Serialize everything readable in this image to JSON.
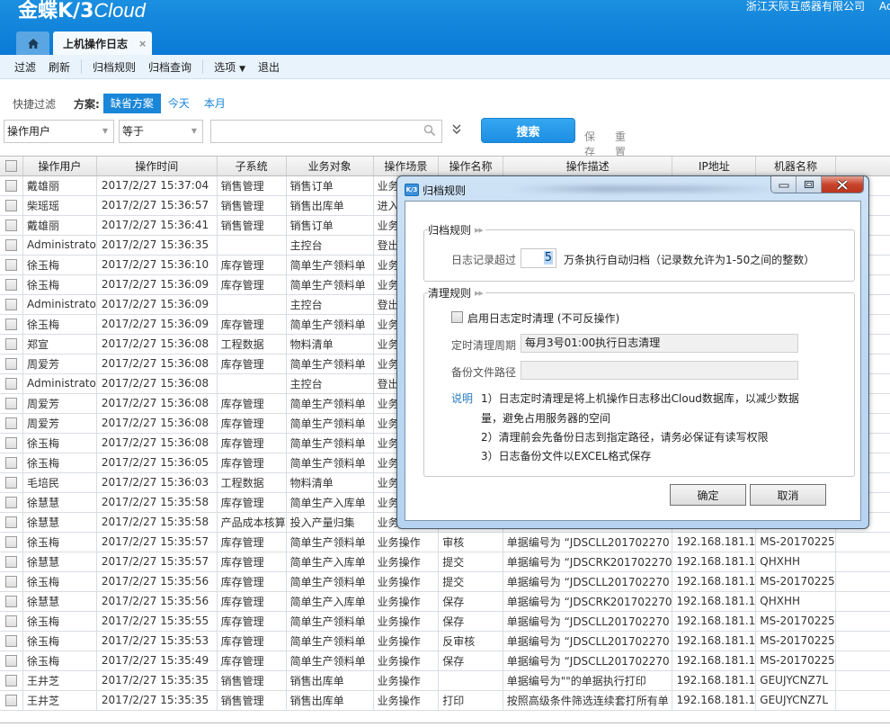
{
  "app": {
    "logo_main": "金蝶K/3",
    "logo_suffix": "Cloud",
    "company": "浙江天际互感器有限公司",
    "user_abbr": "Ac"
  },
  "tabs": {
    "home_icon": "home-icon",
    "active_label": "上机操作日志",
    "close_glyph": "×"
  },
  "toolbar": {
    "items": [
      "过滤",
      "刷新",
      "归档规则",
      "归档查询",
      "选项",
      "退出"
    ],
    "options_caret": "▼"
  },
  "quick_filter": {
    "label": "快捷过滤",
    "scheme_label": "方案:",
    "schemes": [
      "缺省方案",
      "今天",
      "本月"
    ],
    "active_scheme": "缺省方案"
  },
  "filter": {
    "field_value": "操作用户",
    "operator_value": "等于",
    "search_value": "",
    "expand_glyph": "»",
    "search_button": "搜索",
    "save_link": "保存",
    "reset_link": "重置"
  },
  "grid": {
    "columns": [
      "操作用户",
      "操作时间",
      "子系统",
      "业务对象",
      "操作场景",
      "操作名称",
      "操作描述",
      "IP地址",
      "机器名称"
    ],
    "rows": [
      {
        "user": "戴雄丽",
        "time": "2017/2/27 15:37:04",
        "subsystem": "销售管理",
        "object": "销售订单",
        "scene": "业务操作",
        "op": "",
        "desc": "",
        "ip": "",
        "machine": ""
      },
      {
        "user": "柴瑶瑶",
        "time": "2017/2/27 15:36:57",
        "subsystem": "销售管理",
        "object": "销售出库单",
        "scene": "进入业务",
        "op": "",
        "desc": "",
        "ip": "",
        "machine": ""
      },
      {
        "user": "戴雄丽",
        "time": "2017/2/27 15:36:41",
        "subsystem": "销售管理",
        "object": "销售订单",
        "scene": "业务操作",
        "op": "",
        "desc": "",
        "ip": "",
        "machine": ""
      },
      {
        "user": "Administrato",
        "time": "2017/2/27 15:36:35",
        "subsystem": "",
        "object": "主控台",
        "scene": "登出系统",
        "op": "",
        "desc": "",
        "ip": "",
        "machine": ""
      },
      {
        "user": "徐玉梅",
        "time": "2017/2/27 15:36:10",
        "subsystem": "库存管理",
        "object": "简单生产领料单",
        "scene": "业务操作",
        "op": "",
        "desc": "",
        "ip": "",
        "machine": ""
      },
      {
        "user": "徐玉梅",
        "time": "2017/2/27 15:36:09",
        "subsystem": "库存管理",
        "object": "简单生产领料单",
        "scene": "业务操作",
        "op": "",
        "desc": "",
        "ip": "",
        "machine": ""
      },
      {
        "user": "Administrato",
        "time": "2017/2/27 15:36:09",
        "subsystem": "",
        "object": "主控台",
        "scene": "登出系统",
        "op": "",
        "desc": "",
        "ip": "",
        "machine": ""
      },
      {
        "user": "徐玉梅",
        "time": "2017/2/27 15:36:09",
        "subsystem": "库存管理",
        "object": "简单生产领料单",
        "scene": "业务操作",
        "op": "",
        "desc": "",
        "ip": "",
        "machine": ""
      },
      {
        "user": "郑宣",
        "time": "2017/2/27 15:36:08",
        "subsystem": "工程数据",
        "object": "物料清单",
        "scene": "业务操作",
        "op": "",
        "desc": "",
        "ip": "",
        "machine": ""
      },
      {
        "user": "周爱芳",
        "time": "2017/2/27 15:36:08",
        "subsystem": "库存管理",
        "object": "简单生产领料单",
        "scene": "业务操作",
        "op": "",
        "desc": "",
        "ip": "",
        "machine": ""
      },
      {
        "user": "Administrato",
        "time": "2017/2/27 15:36:08",
        "subsystem": "",
        "object": "主控台",
        "scene": "登出系统",
        "op": "",
        "desc": "",
        "ip": "",
        "machine": ""
      },
      {
        "user": "周爱芳",
        "time": "2017/2/27 15:36:08",
        "subsystem": "库存管理",
        "object": "简单生产领料单",
        "scene": "业务操作",
        "op": "",
        "desc": "",
        "ip": "",
        "machine": ""
      },
      {
        "user": "周爱芳",
        "time": "2017/2/27 15:36:08",
        "subsystem": "库存管理",
        "object": "简单生产领料单",
        "scene": "业务操作",
        "op": "",
        "desc": "",
        "ip": "",
        "machine": ""
      },
      {
        "user": "徐玉梅",
        "time": "2017/2/27 15:36:08",
        "subsystem": "库存管理",
        "object": "简单生产领料单",
        "scene": "业务操作",
        "op": "",
        "desc": "",
        "ip": "",
        "machine": ""
      },
      {
        "user": "徐玉梅",
        "time": "2017/2/27 15:36:05",
        "subsystem": "库存管理",
        "object": "简单生产领料单",
        "scene": "业务操作",
        "op": "",
        "desc": "",
        "ip": "",
        "machine": ""
      },
      {
        "user": "毛培民",
        "time": "2017/2/27 15:36:03",
        "subsystem": "工程数据",
        "object": "物料清单",
        "scene": "业务操作",
        "op": "",
        "desc": "",
        "ip": "",
        "machine": ""
      },
      {
        "user": "徐慧慧",
        "time": "2017/2/27 15:35:58",
        "subsystem": "库存管理",
        "object": "简单生产入库单",
        "scene": "业务操作",
        "op": "",
        "desc": "",
        "ip": "",
        "machine": ""
      },
      {
        "user": "徐慧慧",
        "time": "2017/2/27 15:35:58",
        "subsystem": "产品成本核算",
        "object": "投入产量归集",
        "scene": "业务操作",
        "op": "",
        "desc": "",
        "ip": "",
        "machine": ""
      },
      {
        "user": "徐玉梅",
        "time": "2017/2/27 15:35:57",
        "subsystem": "库存管理",
        "object": "简单生产领料单",
        "scene": "业务操作",
        "op": "审核",
        "desc": "单据编号为 “JDSCLL201702270",
        "ip": "192.168.181.1",
        "machine": "MS-20170225"
      },
      {
        "user": "徐慧慧",
        "time": "2017/2/27 15:35:57",
        "subsystem": "库存管理",
        "object": "简单生产入库单",
        "scene": "业务操作",
        "op": "提交",
        "desc": "单据编号为 “JDSCRK201702270",
        "ip": "192.168.181.1",
        "machine": "QHXHH"
      },
      {
        "user": "徐玉梅",
        "time": "2017/2/27 15:35:56",
        "subsystem": "库存管理",
        "object": "简单生产领料单",
        "scene": "业务操作",
        "op": "提交",
        "desc": "单据编号为 “JDSCLL201702270",
        "ip": "192.168.181.1",
        "machine": "MS-20170225"
      },
      {
        "user": "徐慧慧",
        "time": "2017/2/27 15:35:56",
        "subsystem": "库存管理",
        "object": "简单生产入库单",
        "scene": "业务操作",
        "op": "保存",
        "desc": "单据编号为 “JDSCRK201702270",
        "ip": "192.168.181.1",
        "machine": "QHXHH"
      },
      {
        "user": "徐玉梅",
        "time": "2017/2/27 15:35:55",
        "subsystem": "库存管理",
        "object": "简单生产领料单",
        "scene": "业务操作",
        "op": "保存",
        "desc": "单据编号为 “JDSCLL201702270",
        "ip": "192.168.181.1",
        "machine": "MS-20170225"
      },
      {
        "user": "徐玉梅",
        "time": "2017/2/27 15:35:53",
        "subsystem": "库存管理",
        "object": "简单生产领料单",
        "scene": "业务操作",
        "op": "反审核",
        "desc": "单据编号为 “JDSCLL201702270",
        "ip": "192.168.181.1",
        "machine": "MS-20170225"
      },
      {
        "user": "徐玉梅",
        "time": "2017/2/27 15:35:49",
        "subsystem": "库存管理",
        "object": "简单生产领料单",
        "scene": "业务操作",
        "op": "保存",
        "desc": "单据编号为 “JDSCLL201702270",
        "ip": "192.168.181.1",
        "machine": "MS-20170225"
      },
      {
        "user": "王井芝",
        "time": "2017/2/27 15:35:35",
        "subsystem": "销售管理",
        "object": "销售出库单",
        "scene": "业务操作",
        "op": "",
        "desc": "单据编号为\"\"的单据执行打印",
        "ip": "192.168.181.1",
        "machine": "GEUJYCNZ7L"
      },
      {
        "user": "王井芝",
        "time": "2017/2/27 15:35:35",
        "subsystem": "销售管理",
        "object": "销售出库单",
        "scene": "业务操作",
        "op": "打印",
        "desc": "按照高级条件筛选连续套打所有单",
        "ip": "192.168.181.1",
        "machine": "GEUJYCNZ7L"
      }
    ]
  },
  "dialog": {
    "title": "归档规则",
    "icon_text": "K/3",
    "archive_section": {
      "legend": "归档规则",
      "label_before": "日志记录超过",
      "value": "5",
      "label_after": "万条执行自动归档（记录数允许为1-50之间的整数）"
    },
    "cleanup_section": {
      "legend": "清理规则",
      "enable_label": "启用日志定时清理 (不可反操作)",
      "enable_checked": false,
      "period_label": "定时清理周期",
      "period_value": "每月3号01:00执行日志清理",
      "backup_label": "备份文件路径",
      "backup_value": "",
      "note_label": "说明",
      "notes": [
        "1）日志定时清理是将上机操作日志移出Cloud数据库，以减少数据",
        "量，避免占用服务器的空间",
        "2）清理前会先备份日志到指定路径，请务必保证有读写权限",
        "3）日志备份文件以EXCEL格式保存"
      ]
    },
    "ok_button": "确定",
    "cancel_button": "取消"
  },
  "colors": {
    "brand_blue": "#1a86d8",
    "header_blue": "#0a7ad6",
    "close_red": "#c9442c"
  }
}
